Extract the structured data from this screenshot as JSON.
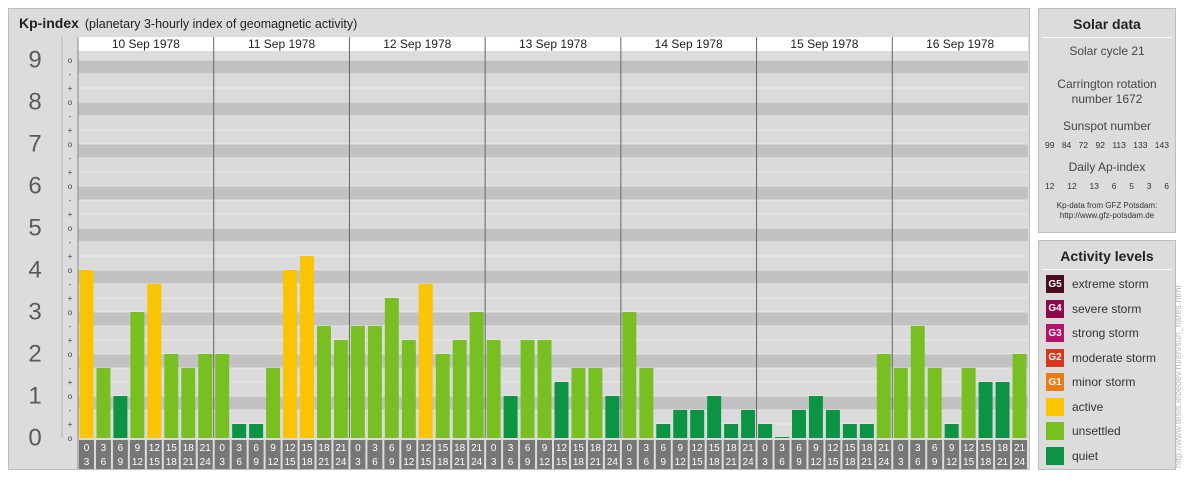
{
  "chart_data": {
    "type": "bar",
    "title": "Kp-index",
    "subtitle": "(planetary 3-hourly index of geomagnetic activity)",
    "ylim": [
      0,
      9
    ],
    "y_ticks": [
      "0",
      "1",
      "2",
      "3",
      "4",
      "5",
      "6",
      "7",
      "8",
      "9"
    ],
    "y_minor_labels": [
      "o",
      "+",
      "-",
      "o",
      "+",
      "-",
      "o",
      "+",
      "-",
      "o",
      "+",
      "-",
      "o",
      "+",
      "-",
      "o",
      "+",
      "-",
      "o",
      "+",
      "-",
      "o",
      "+",
      "-",
      "o",
      "+",
      "-",
      "o"
    ],
    "days": [
      "10 Sep 1978",
      "11 Sep 1978",
      "12 Sep 1978",
      "13 Sep 1978",
      "14 Sep 1978",
      "15 Sep 1978",
      "16 Sep 1978"
    ],
    "interval_start": [
      "0",
      "3",
      "6",
      "9",
      "12",
      "15",
      "18",
      "21"
    ],
    "interval_end": [
      "3",
      "6",
      "9",
      "12",
      "15",
      "18",
      "21",
      "24"
    ],
    "values": [
      4.0,
      1.667,
      1.0,
      3.0,
      3.667,
      2.0,
      1.667,
      2.0,
      2.0,
      0.333,
      0.333,
      1.667,
      4.0,
      4.333,
      2.667,
      2.333,
      2.667,
      2.667,
      3.333,
      2.333,
      3.667,
      2.0,
      2.333,
      3.0,
      2.333,
      1.0,
      2.333,
      2.333,
      1.333,
      1.667,
      1.667,
      1.0,
      3.0,
      1.667,
      0.333,
      0.667,
      0.667,
      1.0,
      0.333,
      0.667,
      0.333,
      0.0,
      0.667,
      1.0,
      0.667,
      0.333,
      0.333,
      2.0,
      1.667,
      2.667,
      1.667,
      0.333,
      1.667,
      1.333,
      1.333,
      2.0
    ],
    "colors": {
      "quiet": "#0a9444",
      "unsettled": "#78c021",
      "active": "#fac400",
      "band_dark": "#c2c2c2",
      "band_light": "#dadada"
    }
  },
  "solar_data": {
    "heading": "Solar data",
    "solar_cycle": "Solar cycle 21",
    "carrington_line1": "Carrington rotation",
    "carrington_line2": "number 1672",
    "sunspot_label": "Sunspot number",
    "sunspot_numbers": [
      "99",
      "84",
      "72",
      "92",
      "113",
      "133",
      "143"
    ],
    "ap_label": "Daily Ap-index",
    "ap_values": [
      "12",
      "12",
      "13",
      "6",
      "5",
      "3",
      "6"
    ],
    "credit_line1": "Kp-data from GFZ Potsdam:",
    "credit_line2": "http://www.gfz-potsdam.de"
  },
  "activity_levels": {
    "heading": "Activity levels",
    "items": [
      {
        "code": "G5",
        "label": "extreme storm",
        "color": "#4a0a24"
      },
      {
        "code": "G4",
        "label": "severe storm",
        "color": "#8c0a4c"
      },
      {
        "code": "G3",
        "label": "strong storm",
        "color": "#b5106a"
      },
      {
        "code": "G2",
        "label": "moderate storm",
        "color": "#d8361f"
      },
      {
        "code": "G1",
        "label": "minor storm",
        "color": "#ec7c12"
      },
      {
        "code": "",
        "label": "active",
        "color": "#fac400"
      },
      {
        "code": "",
        "label": "unsettled",
        "color": "#78c021"
      },
      {
        "code": "",
        "label": "quiet",
        "color": "#0a9444"
      }
    ]
  },
  "watermark": "http://www.tesis.lebedev.ru/en/sun_flares.html"
}
